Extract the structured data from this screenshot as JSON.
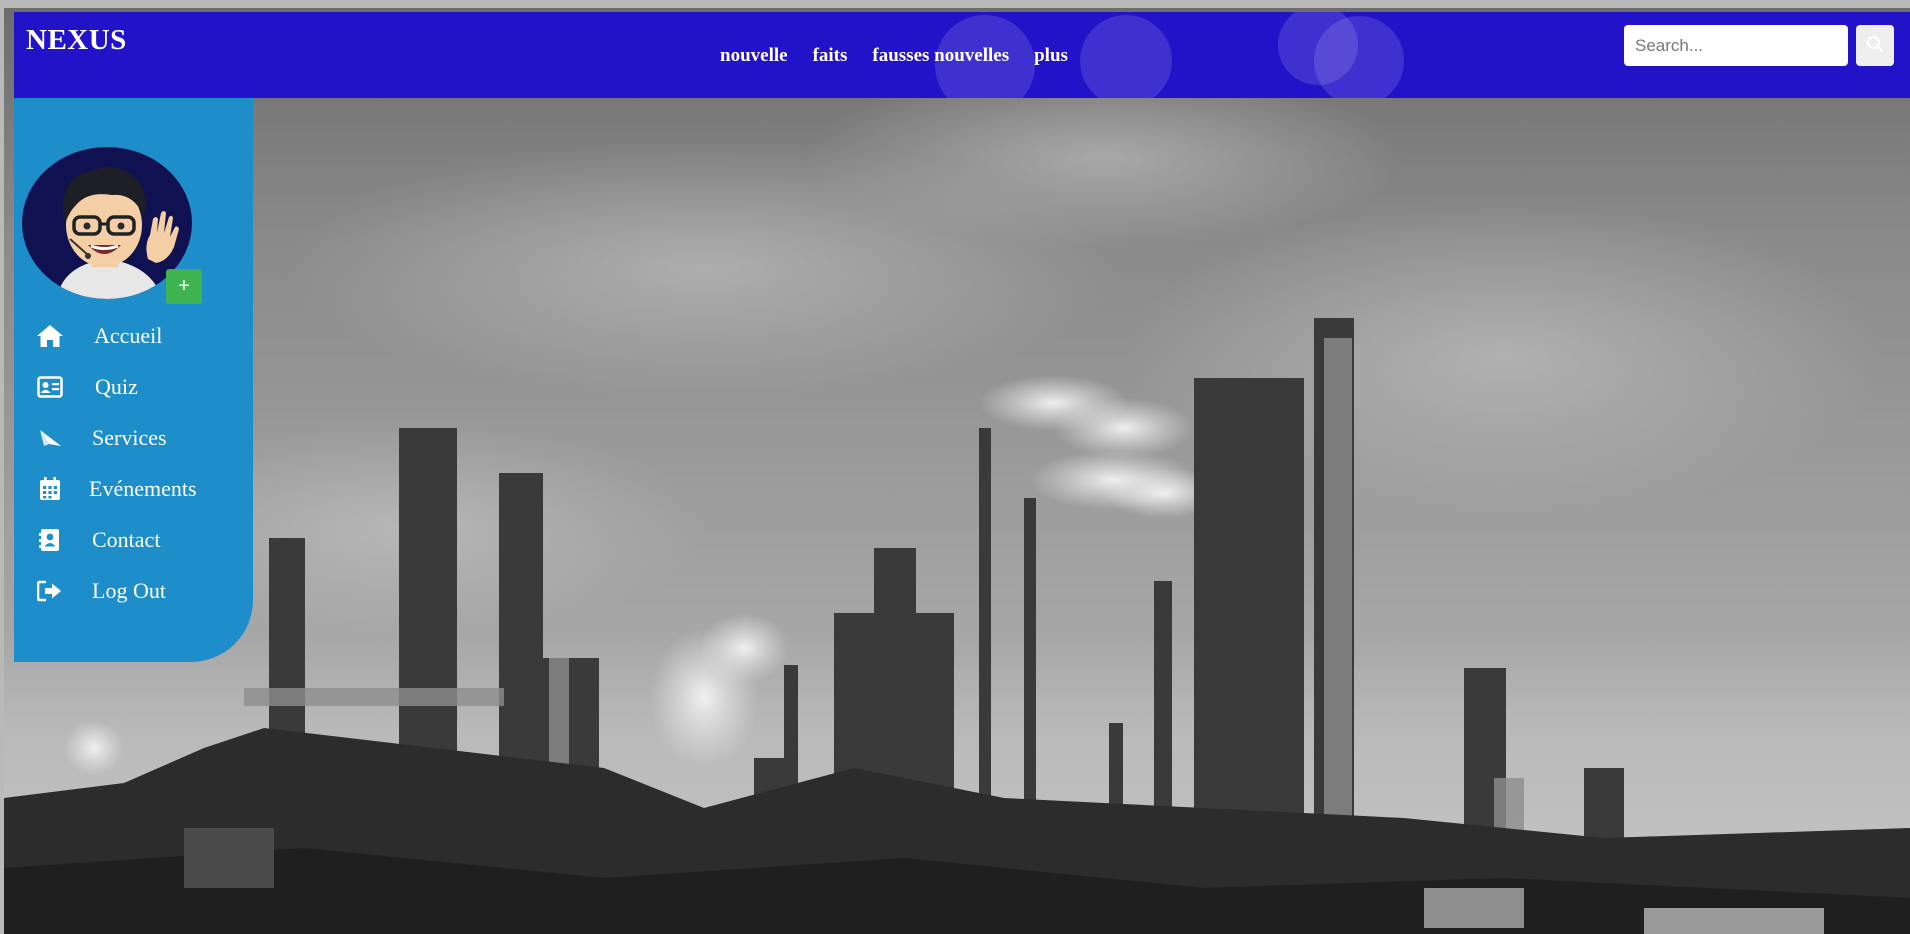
{
  "header": {
    "brand": "NEXUS",
    "nav": [
      "nouvelle",
      "faits",
      "fausses nouvelles",
      "plus"
    ],
    "search": {
      "placeholder": "Search...",
      "value": ""
    },
    "search_button_icon": "search-icon"
  },
  "sidebar": {
    "add_button_label": "+",
    "items": [
      {
        "label": "Accueil",
        "icon": "home-icon"
      },
      {
        "label": "Quiz",
        "icon": "id-card-icon"
      },
      {
        "label": "Services",
        "icon": "paper-plane-icon"
      },
      {
        "label": "Evénements",
        "icon": "calendar-icon"
      },
      {
        "label": "Contact",
        "icon": "address-book-icon"
      },
      {
        "label": "Log Out",
        "icon": "logout-icon"
      }
    ]
  },
  "colors": {
    "topbar": "#2313c8",
    "sidebar": "#1e8ecb",
    "add_button": "#3fb34f",
    "avatar_background": "#0f1150"
  }
}
